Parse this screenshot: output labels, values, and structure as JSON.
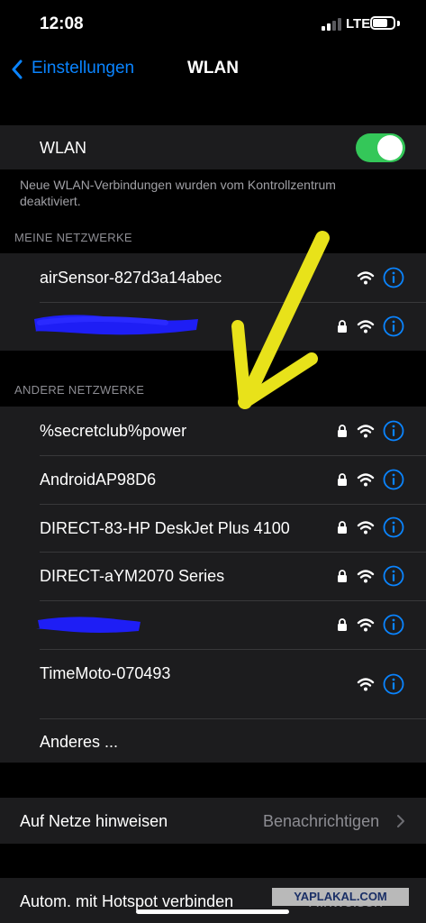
{
  "status": {
    "time": "12:08",
    "network": "LTE"
  },
  "nav": {
    "back_label": "Einstellungen",
    "title": "WLAN"
  },
  "wlan": {
    "label": "WLAN",
    "enabled": true,
    "footnote": "Neue WLAN-Verbindungen wurden vom Kontrollzentrum deaktiviert."
  },
  "my_networks": {
    "header": "MEINE NETZWERKE",
    "items": [
      {
        "name": "airSensor-827d3a14abec",
        "locked": false
      },
      {
        "name": "",
        "locked": true
      }
    ]
  },
  "other_networks": {
    "header": "ANDERE NETZWERKE",
    "items": [
      {
        "name": "%secretclub%power",
        "locked": true
      },
      {
        "name": "AndroidAP98D6",
        "locked": true
      },
      {
        "name": "DIRECT-83-HP DeskJet Plus 4100",
        "locked": true
      },
      {
        "name": "DIRECT-aYM2070 Series",
        "locked": true
      },
      {
        "name": "",
        "locked": true
      },
      {
        "name": "TimeMoto-070493",
        "locked": false
      }
    ],
    "other_label": "Anderes ..."
  },
  "ask_join": {
    "label": "Auf Netze hinweisen",
    "value": "Benachrichtigen"
  },
  "auto_hotspot": {
    "label": "Autom. mit Hotspot verbinden",
    "value": "Hinweisen"
  },
  "watermark": "YAPLAKAL.COM",
  "colors": {
    "accent": "#0a84ff",
    "toggle_on": "#34c759",
    "annotation": "#e8e21a",
    "redaction": "#1e1ef5"
  }
}
